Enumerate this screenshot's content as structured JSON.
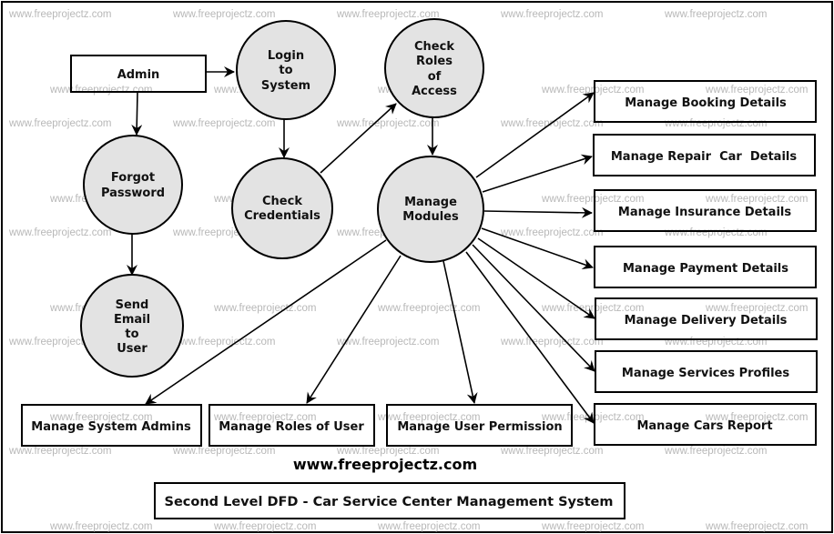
{
  "watermark": "www.freeprojectz.com",
  "site_label": "www.freeprojectz.com",
  "caption": "Second Level DFD - Car Service Center Management System",
  "colors": {
    "process_fill": "#e3e3e3",
    "stroke": "#000000",
    "background": "#ffffff",
    "watermark": "#b8b8b8"
  },
  "entities": {
    "admin": "Admin",
    "booking": "Manage Booking Details",
    "repair": "Manage Repair  Car  Details",
    "insurance": "Manage Insurance Details",
    "payment": "Manage Payment Details",
    "delivery": "Manage Delivery Details",
    "services": "Manage Services Profiles",
    "cars_report": "Manage Cars Report",
    "system_admins": "Manage System Admins",
    "roles_of_user": "Manage Roles of User",
    "user_permission": "Manage User Permission"
  },
  "processes": {
    "login": [
      "Login",
      "to",
      "System"
    ],
    "check_roles": [
      "Check",
      "Roles",
      "of",
      "Access"
    ],
    "forgot": [
      "Forgot",
      "Password"
    ],
    "check_credentials": [
      "Check",
      "Credentials"
    ],
    "manage_modules": [
      "Manage",
      "Modules"
    ],
    "send_email": [
      "Send",
      "Email",
      "to",
      "User"
    ]
  },
  "flows": [
    {
      "from": "admin",
      "to": "login"
    },
    {
      "from": "admin",
      "to": "forgot"
    },
    {
      "from": "login",
      "to": "check_credentials"
    },
    {
      "from": "check_credentials",
      "to": "check_roles"
    },
    {
      "from": "check_roles",
      "to": "manage_modules"
    },
    {
      "from": "forgot",
      "to": "send_email"
    },
    {
      "from": "manage_modules",
      "to": "booking"
    },
    {
      "from": "manage_modules",
      "to": "repair"
    },
    {
      "from": "manage_modules",
      "to": "insurance"
    },
    {
      "from": "manage_modules",
      "to": "payment"
    },
    {
      "from": "manage_modules",
      "to": "delivery"
    },
    {
      "from": "manage_modules",
      "to": "services"
    },
    {
      "from": "manage_modules",
      "to": "cars_report"
    },
    {
      "from": "manage_modules",
      "to": "system_admins"
    },
    {
      "from": "manage_modules",
      "to": "roles_of_user"
    },
    {
      "from": "manage_modules",
      "to": "user_permission"
    }
  ]
}
